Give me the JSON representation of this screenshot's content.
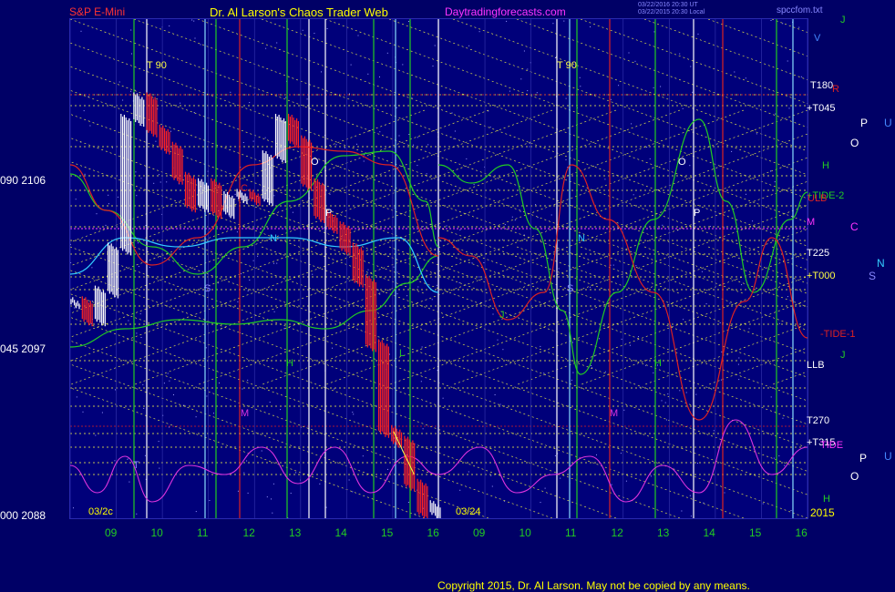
{
  "header": {
    "instrument": "S&P E-Mini",
    "title": "Dr. Al Larson's Chaos Trader Web",
    "site": "Daytradingforecasts.com",
    "timestamp_line1": "03/22/2016 20:30 UT",
    "timestamp_line2": "03/22/2015 20:30 Local",
    "file": "spccfom.txt"
  },
  "left_axis": [
    {
      "label": "090  2106"
    },
    {
      "label": "045  2097"
    },
    {
      "label": "000  2088"
    }
  ],
  "date_labels": [
    "03/2c",
    "03/24"
  ],
  "year_label": "2015",
  "chart_data": {
    "type": "line",
    "title": "",
    "x_ticks": [
      "09",
      "10",
      "11",
      "12",
      "13",
      "14",
      "15",
      "16",
      "09",
      "10",
      "11",
      "12",
      "13",
      "14",
      "15",
      "16"
    ],
    "ylim": [
      2088,
      2111
    ],
    "y_ticks": [
      2088,
      2097,
      2106
    ],
    "price_series": {
      "x": [
        0.0,
        0.25,
        0.5,
        0.75,
        1.0,
        1.25,
        1.5,
        1.75,
        2.0,
        2.25,
        2.5,
        2.75,
        3.0,
        3.25,
        3.5,
        3.75,
        4.0,
        4.25,
        4.5,
        4.75,
        5.0,
        5.25,
        5.5,
        5.75,
        6.0,
        6.25,
        6.5,
        6.75,
        7.0
      ],
      "y": [
        2098.0,
        2097.2,
        2098.5,
        2100.5,
        2106.5,
        2107.5,
        2106.0,
        2105.2,
        2103.8,
        2102.5,
        2103.5,
        2102.2,
        2102.9,
        2103.0,
        2102.8,
        2104.8,
        2106.5,
        2105.5,
        2103.5,
        2102.0,
        2101.5,
        2100.5,
        2099.0,
        2096.0,
        2092.0,
        2091.5,
        2089.5,
        2088.2,
        2088.5
      ]
    },
    "vertical_markers": [
      "T 90",
      "T 90"
    ],
    "right_labels": [
      "V",
      "J",
      "T180",
      "R",
      "+T045",
      "H",
      "+TIDE-2",
      "ULB",
      "M",
      "T225",
      "+T000",
      "-TIDE-1",
      "J",
      "LLB",
      "T270",
      "+T315",
      "TIDE",
      "H",
      "2015"
    ],
    "plot_letters": [
      "O",
      "C",
      "P",
      "S",
      "N",
      "M",
      "H",
      "L",
      "T",
      "O",
      "P",
      "S",
      "N",
      "M",
      "H",
      "J"
    ],
    "far_right_letters": [
      "P",
      "U",
      "O",
      "C",
      "N",
      "S",
      "P",
      "U",
      "O"
    ]
  },
  "footer": {
    "copyright": "Copyright 2015, Dr. Al Larson. May not be copied by any means."
  },
  "colors": {
    "background": "#000066",
    "plot_bg": "#00007a",
    "grid_dotted": "#ffff44",
    "green_line": "#22cc22",
    "red_line": "#dd2222",
    "magenta_line": "#dd33dd",
    "cyan_line": "#33ccff",
    "white_bars": "#ffffff"
  }
}
